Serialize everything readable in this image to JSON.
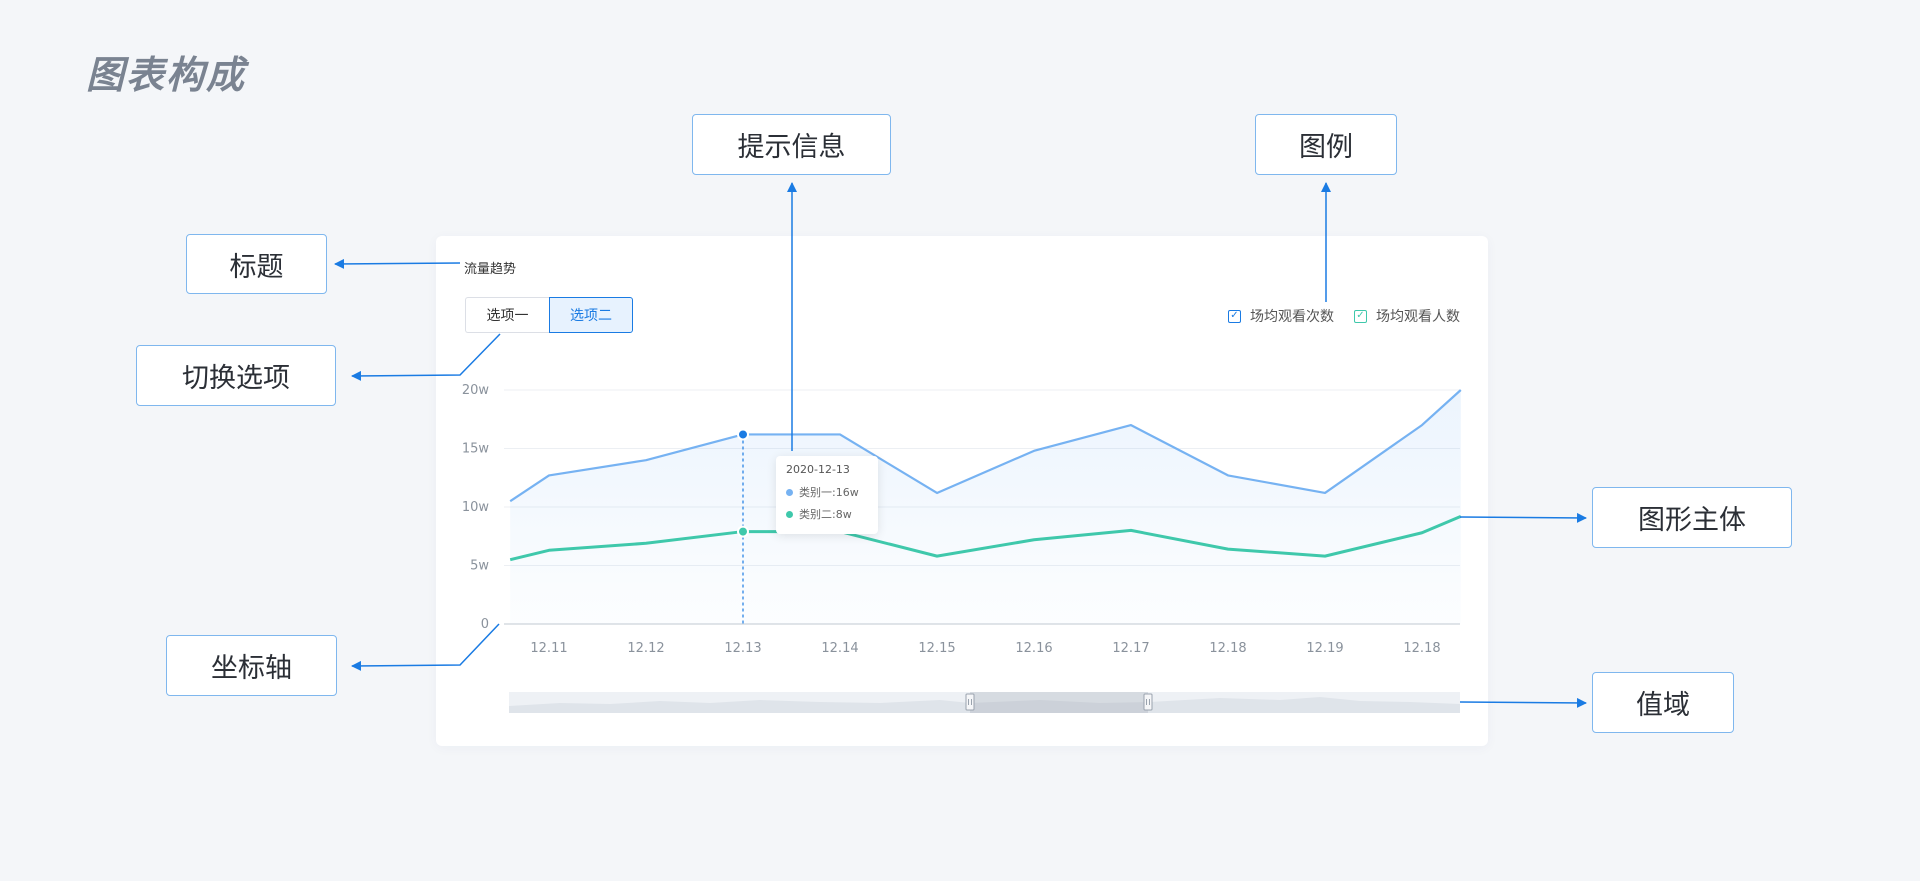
{
  "page_title": "图表构成",
  "callouts": {
    "title": "标题",
    "switch_option": "切换选项",
    "tooltip": "提示信息",
    "legend": "图例",
    "graphic_body": "图形主体",
    "axis": "坐标轴",
    "value_range": "值域"
  },
  "chart": {
    "title": "流量趋势",
    "options": [
      "选项一",
      "选项二"
    ],
    "active_option": "选项二",
    "legend": [
      "场均观看次数",
      "场均观看人数"
    ],
    "tooltip": {
      "date": "2020-12-13",
      "rows": [
        "类别一:16w",
        "类别二:8w"
      ]
    }
  },
  "chart_data": {
    "type": "area",
    "title": "流量趋势",
    "categories": [
      "12.11",
      "12.12",
      "12.13",
      "12.14",
      "12.15",
      "12.16",
      "12.17",
      "12.18",
      "12.19",
      "12.18"
    ],
    "x_values": [
      10.6,
      11,
      12,
      13,
      14,
      15,
      16,
      17,
      18,
      19,
      20,
      20.4
    ],
    "series": [
      {
        "name": "场均观看次数",
        "color": "#76b2f2",
        "values": [
          10.5,
          12.7,
          14,
          16.2,
          16.2,
          11.2,
          14.8,
          17,
          12.7,
          11.2,
          17,
          20
        ]
      },
      {
        "name": "场均观看人数",
        "color": "#3fc8ab",
        "values": [
          5.5,
          6.3,
          6.9,
          7.9,
          7.9,
          5.8,
          7.2,
          8,
          6.4,
          5.8,
          7.8,
          9.2
        ]
      }
    ],
    "yticks": [
      "0",
      "5w",
      "10w",
      "15w",
      "20w"
    ],
    "ylim": [
      0,
      20
    ],
    "grid": true,
    "legend_position": "top-right",
    "highlight_category": "12.13"
  },
  "colors": {
    "accent": "#1a7be3",
    "callout_border": "#7fb7ee",
    "series1": "#76b2f2",
    "series2": "#3fc8ab"
  }
}
